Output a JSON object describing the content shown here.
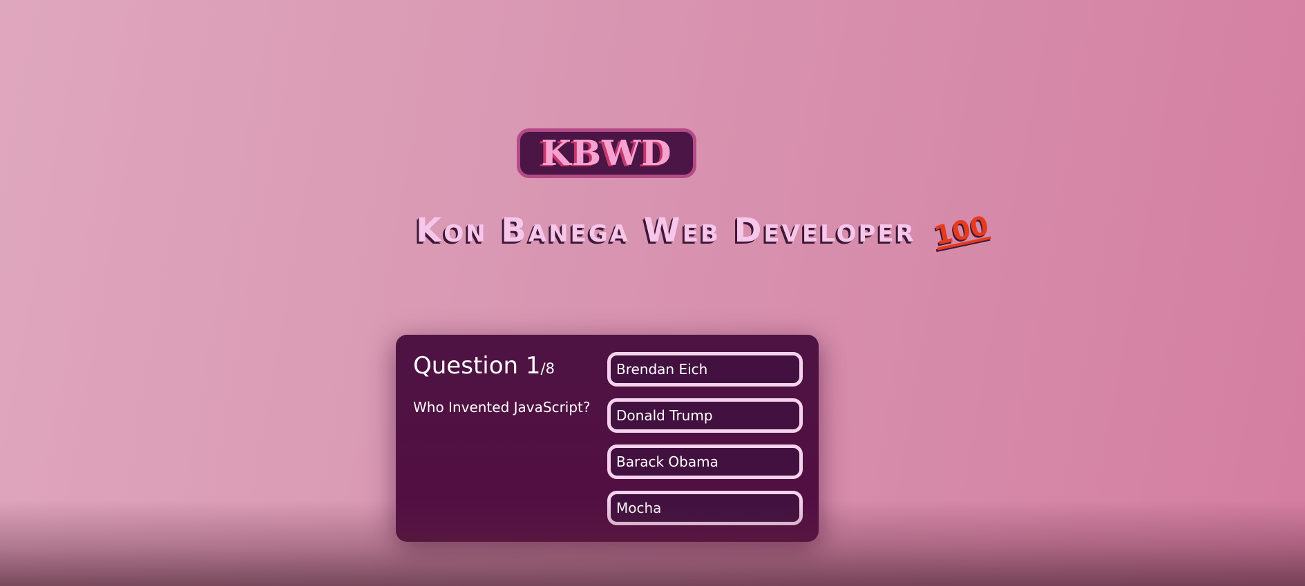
{
  "header": {
    "logo_text": "KBWD",
    "subtitle": "Kon Banega Web Developer",
    "subtitle_emoji": "100"
  },
  "quiz": {
    "question_label": "Question",
    "current_question": "1",
    "total_questions": "/8",
    "question_text": "Who Invented JavaScript?",
    "answers": [
      {
        "label": "Brendan Eich"
      },
      {
        "label": "Donald Trump"
      },
      {
        "label": "Barack Obama"
      },
      {
        "label": "Mocha"
      }
    ]
  },
  "colors": {
    "card_bg": "#4d1343",
    "answer_border": "#f5d3ec",
    "logo_border": "#b44b87",
    "logo_text": "#f7a3d2"
  }
}
